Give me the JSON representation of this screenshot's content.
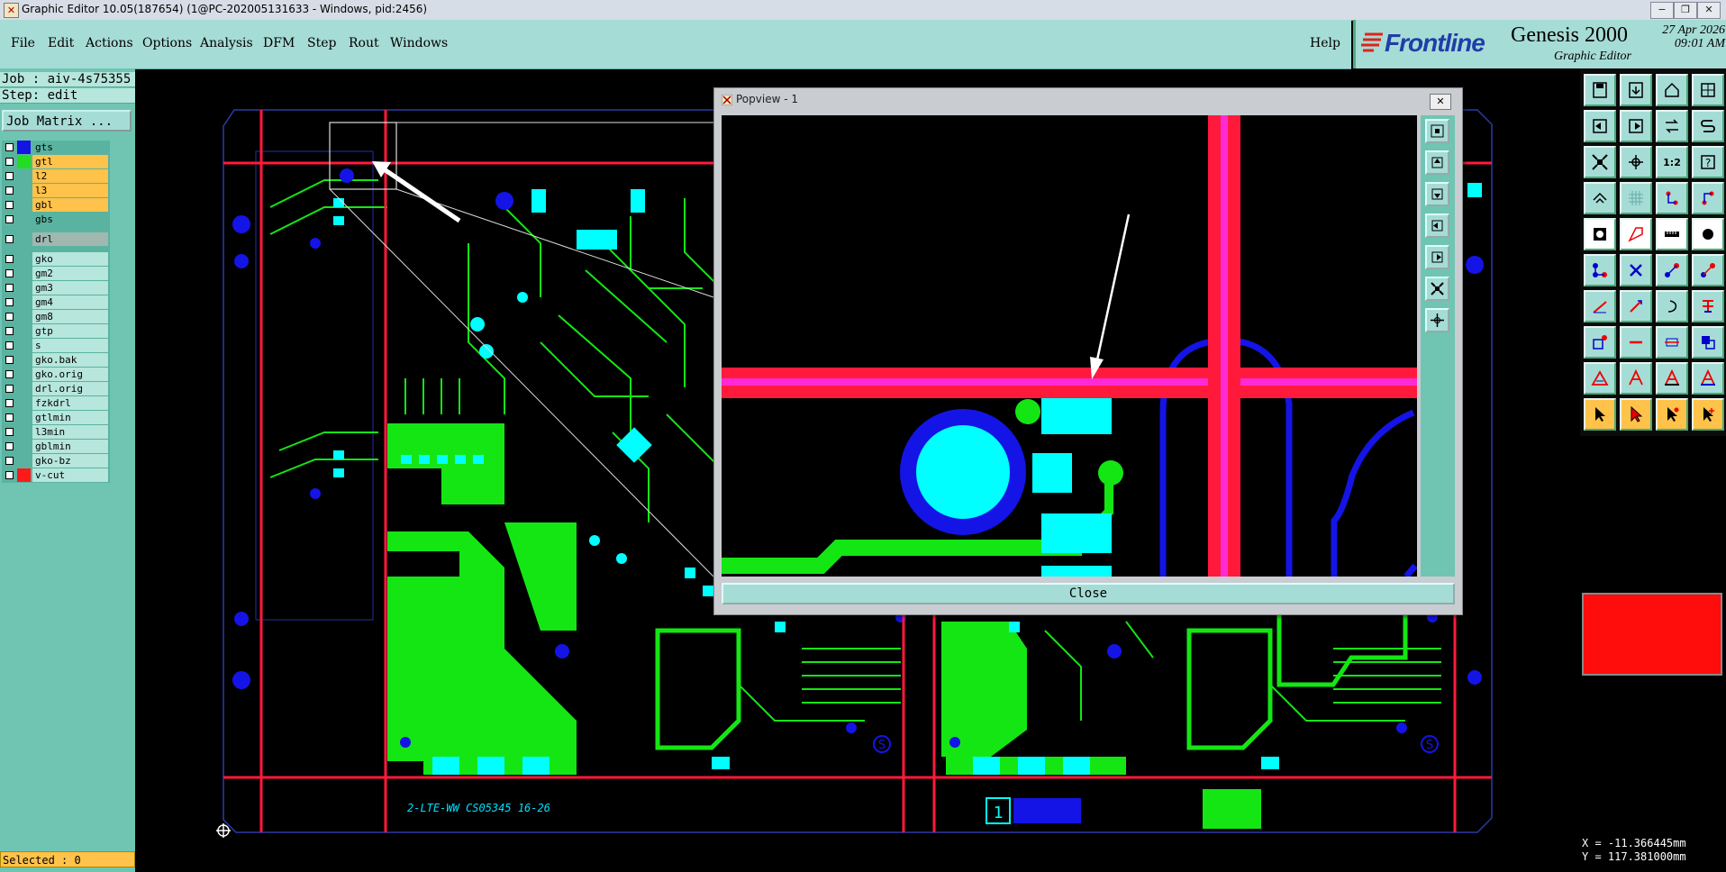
{
  "window": {
    "title": "Graphic Editor 10.05(187654) (1@PC-202005131633 - Windows, pid:2456)",
    "minimize": "−",
    "restore": "❐",
    "close": "✕"
  },
  "menu": {
    "items": [
      "File",
      "Edit",
      "Actions",
      "Options",
      "Analysis",
      "DFM",
      "Step",
      "Rout",
      "Windows"
    ],
    "help": "Help"
  },
  "logo": {
    "brand": "Frontline",
    "product": "Genesis 2000",
    "subtitle": "Graphic Editor",
    "date": "27 Apr 2026",
    "time": "09:01 AM"
  },
  "left_panel": {
    "job": "Job : aiv-4s75355",
    "step": "Step: edit",
    "job_matrix": "Job Matrix ...",
    "selected": "Selected : 0",
    "layers": [
      {
        "name": "gts",
        "swatch": "#1414e6",
        "bg": "#5ab3a0"
      },
      {
        "name": "gtl",
        "swatch": "#22dd22",
        "bg": "#ffc24a"
      },
      {
        "name": "l2",
        "swatch": "",
        "bg": "#ffc24a"
      },
      {
        "name": "l3",
        "swatch": "",
        "bg": "#ffc24a"
      },
      {
        "name": "gbl",
        "swatch": "",
        "bg": "#ffc24a"
      },
      {
        "name": "gbs",
        "swatch": "",
        "bg": "#5ab3a0"
      },
      {
        "name": "drl",
        "swatch": "",
        "bg": "#a0b8b0"
      },
      {
        "name": "gko",
        "swatch": "",
        "bg": "#b6e6dc"
      },
      {
        "name": "gm2",
        "swatch": "",
        "bg": "#b6e6dc"
      },
      {
        "name": "gm3",
        "swatch": "",
        "bg": "#b6e6dc"
      },
      {
        "name": "gm4",
        "swatch": "",
        "bg": "#b6e6dc"
      },
      {
        "name": "gm8",
        "swatch": "",
        "bg": "#b6e6dc"
      },
      {
        "name": "gtp",
        "swatch": "",
        "bg": "#b6e6dc"
      },
      {
        "name": "s",
        "swatch": "",
        "bg": "#b6e6dc"
      },
      {
        "name": "gko.bak",
        "swatch": "",
        "bg": "#b6e6dc"
      },
      {
        "name": "gko.orig",
        "swatch": "",
        "bg": "#b6e6dc"
      },
      {
        "name": "drl.orig",
        "swatch": "",
        "bg": "#b6e6dc"
      },
      {
        "name": "fzkdrl",
        "swatch": "",
        "bg": "#b6e6dc"
      },
      {
        "name": "gtlmin",
        "swatch": "",
        "bg": "#b6e6dc"
      },
      {
        "name": "l3min",
        "swatch": "",
        "bg": "#b6e6dc"
      },
      {
        "name": "gblmin",
        "swatch": "",
        "bg": "#b6e6dc"
      },
      {
        "name": "gko-bz",
        "swatch": "",
        "bg": "#b6e6dc"
      },
      {
        "name": "v-cut",
        "swatch": "#ff1a1a",
        "bg": "#b6e6dc"
      }
    ]
  },
  "board": {
    "silk_text": "2-LTE-WW   CS05345   16-26",
    "fiducial_number": "1",
    "panel_marker": "S"
  },
  "popview": {
    "title": "Popview - 1",
    "close_label": "Close",
    "close_x": "✕"
  },
  "coords": {
    "x": "X = -11.366445mm",
    "y": "Y = 117.381000mm"
  },
  "colors": {
    "vcut": "#ff1a3c",
    "copper": "#14e614",
    "pad": "#00ffff",
    "mask": "#1414e6",
    "active_color": "#ff0d0d"
  },
  "toolbar_icons": [
    "save-icon",
    "open-icon",
    "home-icon",
    "layers-icon",
    "left-icon",
    "right-icon",
    "swap-icon",
    "s-curve-icon",
    "fit-icon",
    "pan-icon",
    "scale-icon",
    "query-icon",
    "snap-icon",
    "grid-icon",
    "net-icon",
    "net2-icon",
    "pad-icon",
    "shape-icon",
    "ruler-icon",
    "dot-icon",
    "nodes-icon",
    "cross-icon",
    "link-icon",
    "link2-icon",
    "line-icon",
    "slash-icon",
    "arc-icon",
    "split-icon",
    "select-area-icon",
    "minus-icon",
    "measure-icon",
    "copy-icon",
    "triangle-icon",
    "a-icon",
    "a-icon2",
    "a-icon3",
    "pointer-icon",
    "pointer2-icon",
    "pointer3-icon",
    "pointer4-icon"
  ]
}
